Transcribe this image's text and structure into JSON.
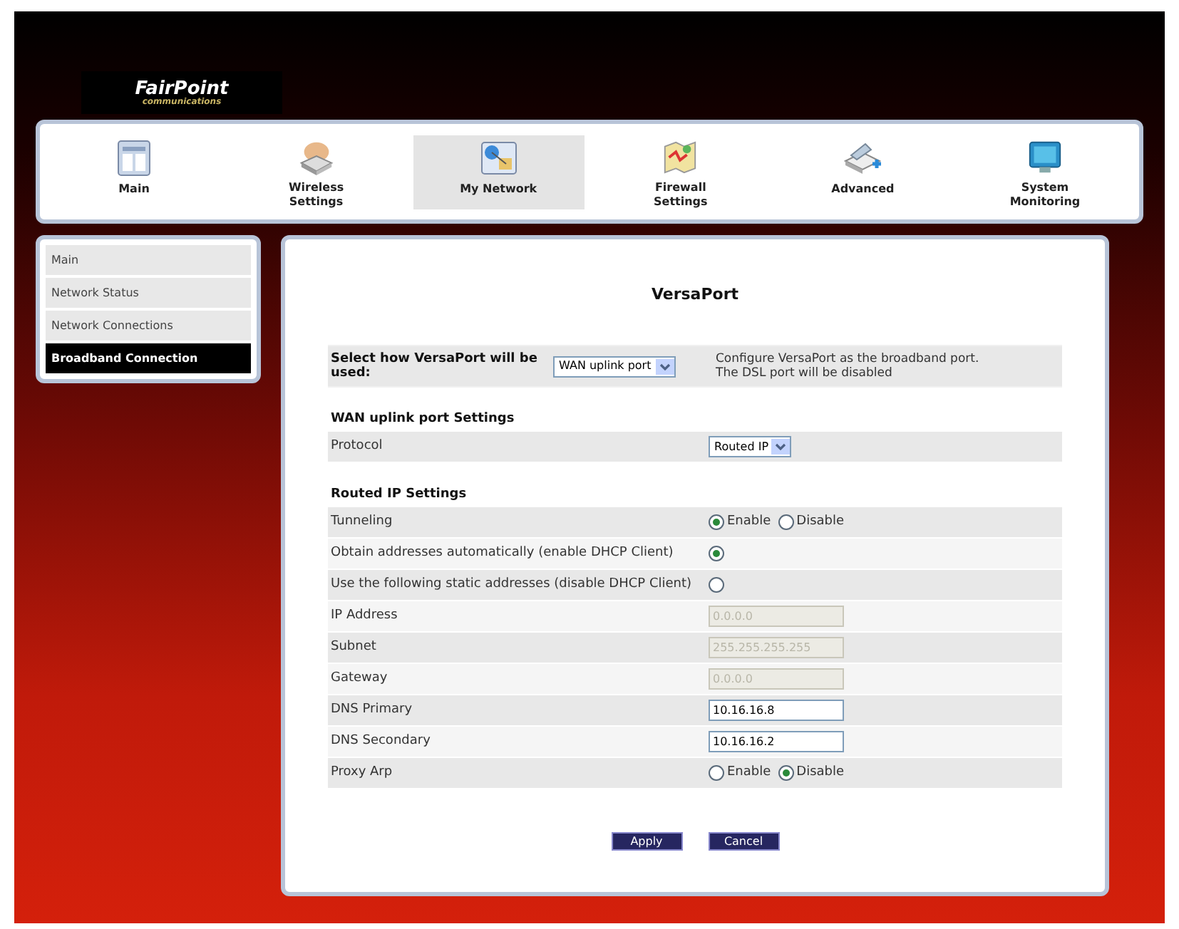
{
  "logo": {
    "name": "FairPoint",
    "tagline": "communications"
  },
  "nav": [
    {
      "label": "Main",
      "selected": false
    },
    {
      "label": "Wireless Settings",
      "selected": false
    },
    {
      "label": "My Network",
      "selected": true
    },
    {
      "label": "Firewall Settings",
      "selected": false
    },
    {
      "label": "Advanced",
      "selected": false
    },
    {
      "label": "System Monitoring",
      "selected": false
    }
  ],
  "sidebar": {
    "items": [
      {
        "label": "Main",
        "selected": false
      },
      {
        "label": "Network Status",
        "selected": false
      },
      {
        "label": "Network Connections",
        "selected": false
      },
      {
        "label": "Broadband Connection",
        "selected": true
      }
    ]
  },
  "page": {
    "title": "VersaPort",
    "usage": {
      "label": "Select how VersaPort will be used:",
      "value": "WAN uplink port",
      "note": [
        "Configure VersaPort as the broadband port.",
        "The DSL port will be disabled"
      ]
    },
    "sections": [
      {
        "title": "WAN uplink port Settings",
        "rows": [
          {
            "kind": "select",
            "label": "Protocol",
            "value": "Routed IP"
          }
        ]
      },
      {
        "title": "Routed IP Settings",
        "rows": [
          {
            "kind": "choice",
            "label": "Tunneling",
            "options": [
              {
                "label": "Enable",
                "selected": true
              },
              {
                "label": "Disable",
                "selected": false
              }
            ]
          },
          {
            "kind": "radio",
            "label": "Obtain addresses automatically (enable DHCP Client)",
            "selected": true
          },
          {
            "kind": "radio",
            "label": "Use the following static addresses (disable DHCP Client)",
            "selected": false
          },
          {
            "kind": "field",
            "label": "IP Address",
            "value": "0.0.0.0",
            "disabled": true
          },
          {
            "kind": "field",
            "label": "Subnet",
            "value": "255.255.255.255",
            "disabled": true
          },
          {
            "kind": "field",
            "label": "Gateway",
            "value": "0.0.0.0",
            "disabled": true
          },
          {
            "kind": "field",
            "label": "DNS Primary",
            "value": "10.16.16.8",
            "disabled": false
          },
          {
            "kind": "field",
            "label": "DNS Secondary",
            "value": "10.16.16.2",
            "disabled": false
          },
          {
            "kind": "choice",
            "label": "Proxy Arp",
            "options": [
              {
                "label": "Enable",
                "selected": false
              },
              {
                "label": "Disable",
                "selected": true
              }
            ]
          }
        ]
      }
    ],
    "buttons": [
      "Apply",
      "Cancel"
    ]
  }
}
